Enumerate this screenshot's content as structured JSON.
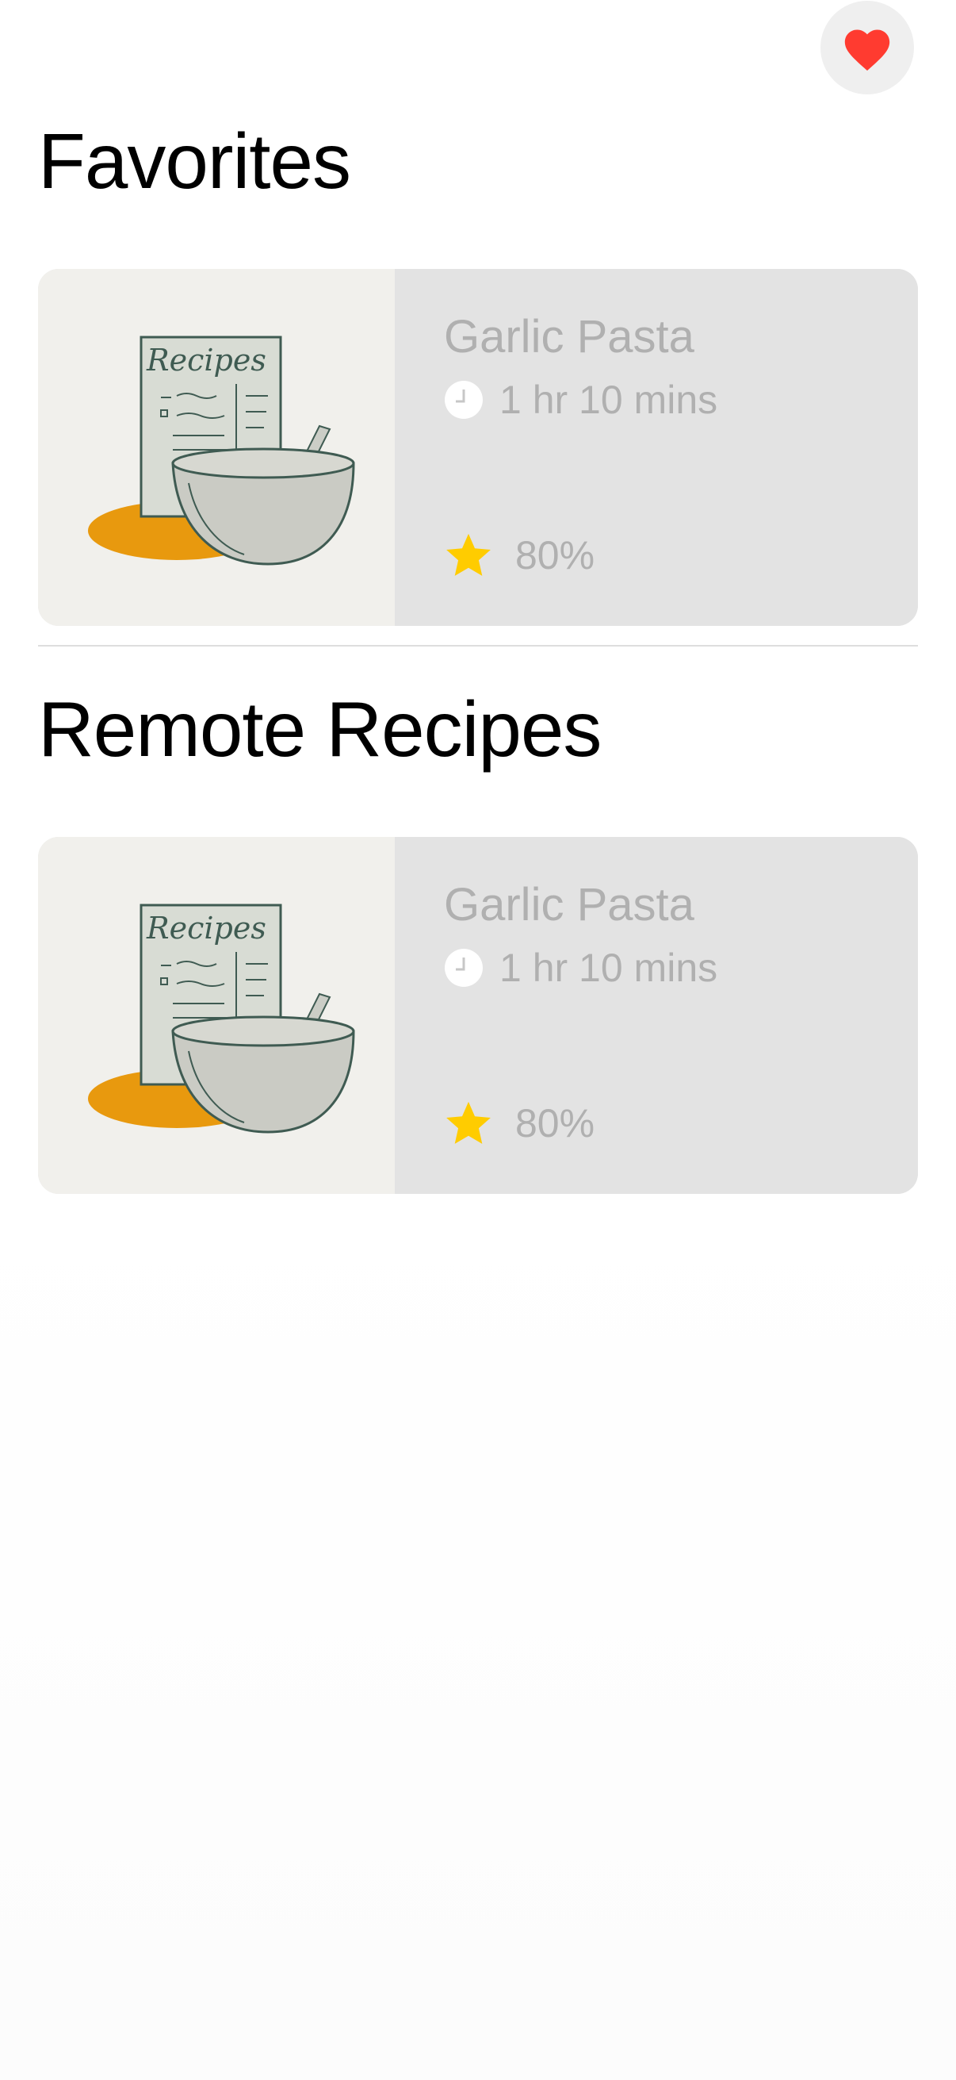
{
  "header": {
    "favorites_toggle_icon": "heart-icon",
    "favorites_toggle_color": "#ff3b30"
  },
  "favorites": {
    "title": "Favorites",
    "items": [
      {
        "name": "Garlic Pasta",
        "time": "1 hr 10 mins",
        "rating": "80%",
        "image_text": "Recipes",
        "image_icon": "recipe-book-and-bowl"
      }
    ]
  },
  "remote": {
    "title": "Remote Recipes",
    "items": [
      {
        "name": "Garlic Pasta",
        "time": "1 hr 10 mins",
        "rating": "80%",
        "image_text": "Recipes",
        "image_icon": "recipe-book-and-bowl"
      }
    ]
  },
  "colors": {
    "star": "#ffcc00",
    "heart": "#ff3b30",
    "muted_text": "#b0b0b0",
    "card_background": "#e3e3e3"
  }
}
